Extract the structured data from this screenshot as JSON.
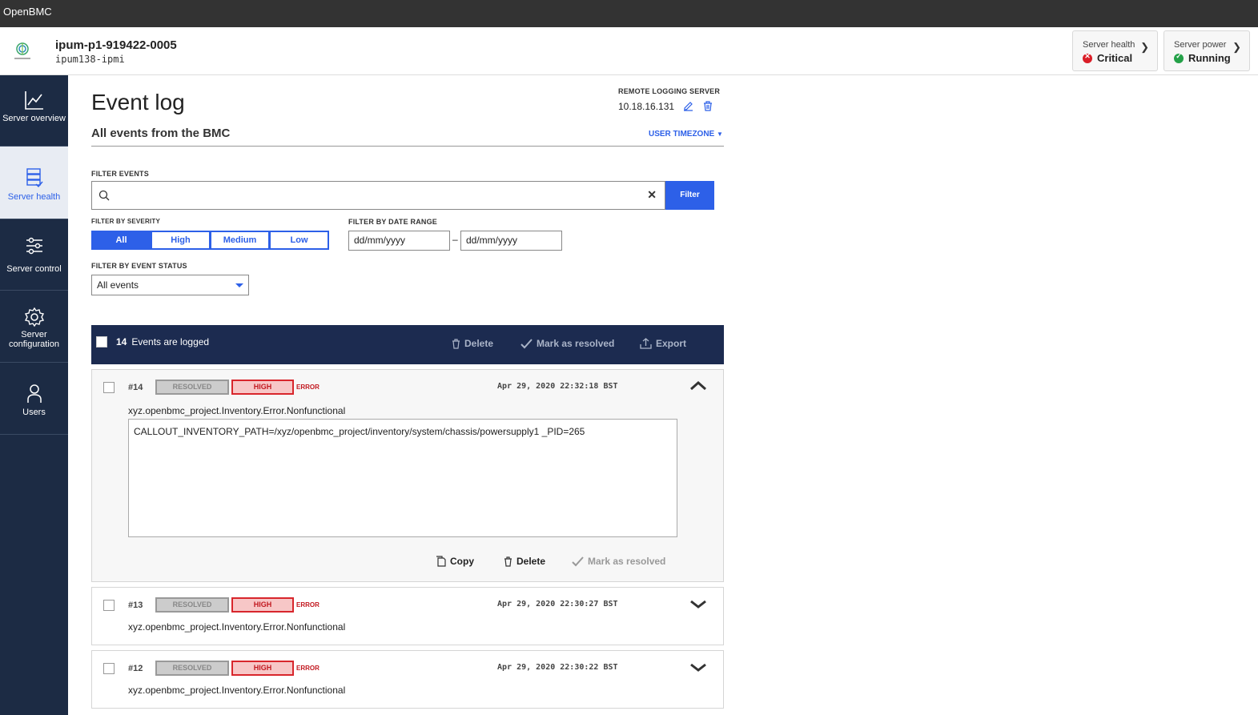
{
  "app": {
    "title": "OpenBMC"
  },
  "header": {
    "host_name": "ipum-p1-919422-0005",
    "host_sub": "ipum138-ipmi",
    "server_health": {
      "label": "Server health",
      "value": "Critical"
    },
    "server_power": {
      "label": "Server power",
      "value": "Running"
    }
  },
  "sidebar": {
    "items": [
      {
        "label": "Server overview",
        "icon": "chart-icon"
      },
      {
        "label": "Server health",
        "icon": "server-health-icon",
        "active": true
      },
      {
        "label": "Server control",
        "icon": "sliders-icon"
      },
      {
        "label": "Server configuration",
        "icon": "gear-icon"
      },
      {
        "label": "Users",
        "icon": "user-icon"
      }
    ]
  },
  "page": {
    "title": "Event log",
    "remote_logging_label": "REMOTE LOGGING SERVER",
    "remote_logging_ip": "10.18.16.131",
    "subtitle": "All events from the BMC",
    "timezone": "USER TIMEZONE"
  },
  "filters": {
    "search_label": "FILTER EVENTS",
    "search_value": "",
    "filter_button": "Filter",
    "severity_label": "FILTER BY SEVERITY",
    "severity_options": [
      "All",
      "High",
      "Medium",
      "Low"
    ],
    "date_label": "FILTER BY DATE RANGE",
    "date_from": "dd/mm/yyyy",
    "date_to": "dd/mm/yyyy",
    "date_separator": "–",
    "status_label": "FILTER BY EVENT STATUS",
    "status_value": "All events"
  },
  "toolbar": {
    "count": "14",
    "count_label": "Events are logged",
    "delete": "Delete",
    "mark_resolved": "Mark as resolved",
    "export": "Export"
  },
  "events": [
    {
      "id": "#14",
      "resolved": "RESOLVED",
      "severity": "HIGH",
      "type": "ERROR",
      "timestamp": "Apr 29, 2020 22:32:18 BST",
      "message": "xyz.openbmc_project.Inventory.Error.Nonfunctional",
      "detail": "CALLOUT_INVENTORY_PATH=/xyz/openbmc_project/inventory/system/chassis/powersupply1 _PID=265",
      "actions": {
        "copy": "Copy",
        "delete": "Delete",
        "mark_resolved": "Mark as resolved"
      }
    },
    {
      "id": "#13",
      "resolved": "RESOLVED",
      "severity": "HIGH",
      "type": "ERROR",
      "timestamp": "Apr 29, 2020 22:30:27 BST",
      "message": "xyz.openbmc_project.Inventory.Error.Nonfunctional"
    },
    {
      "id": "#12",
      "resolved": "RESOLVED",
      "severity": "HIGH",
      "type": "ERROR",
      "timestamp": "Apr 29, 2020 22:30:22 BST",
      "message": "xyz.openbmc_project.Inventory.Error.Nonfunctional"
    }
  ],
  "colors": {
    "accent": "#2d60e8",
    "sidebar": "#1c2b44",
    "toolbar": "#1c2b50",
    "critical": "#da1e28",
    "running": "#24a148"
  }
}
